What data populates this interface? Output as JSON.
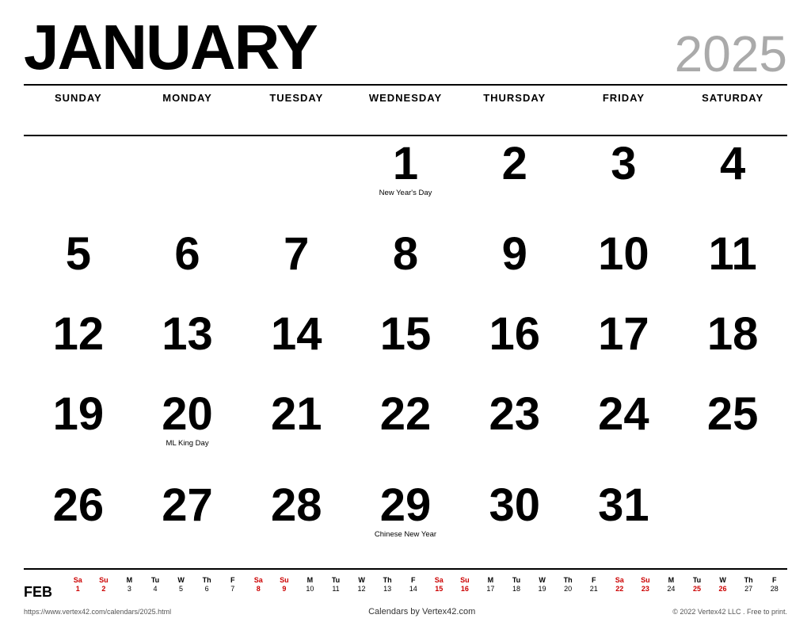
{
  "header": {
    "month": "JANUARY",
    "year": "2025"
  },
  "day_headers": [
    "SUNDAY",
    "MONDAY",
    "TUESDAY",
    "WEDNESDAY",
    "THURSDAY",
    "FRIDAY",
    "SATURDAY"
  ],
  "weeks": [
    [
      {
        "day": "",
        "holiday": ""
      },
      {
        "day": "",
        "holiday": ""
      },
      {
        "day": "",
        "holiday": ""
      },
      {
        "day": "1",
        "holiday": "New Year's Day"
      },
      {
        "day": "2",
        "holiday": ""
      },
      {
        "day": "3",
        "holiday": ""
      },
      {
        "day": "4",
        "holiday": ""
      }
    ],
    [
      {
        "day": "5",
        "holiday": ""
      },
      {
        "day": "6",
        "holiday": ""
      },
      {
        "day": "7",
        "holiday": ""
      },
      {
        "day": "8",
        "holiday": ""
      },
      {
        "day": "9",
        "holiday": ""
      },
      {
        "day": "10",
        "holiday": ""
      },
      {
        "day": "11",
        "holiday": ""
      }
    ],
    [
      {
        "day": "12",
        "holiday": ""
      },
      {
        "day": "13",
        "holiday": ""
      },
      {
        "day": "14",
        "holiday": ""
      },
      {
        "day": "15",
        "holiday": ""
      },
      {
        "day": "16",
        "holiday": ""
      },
      {
        "day": "17",
        "holiday": ""
      },
      {
        "day": "18",
        "holiday": ""
      }
    ],
    [
      {
        "day": "19",
        "holiday": ""
      },
      {
        "day": "20",
        "holiday": "ML King Day"
      },
      {
        "day": "21",
        "holiday": ""
      },
      {
        "day": "22",
        "holiday": ""
      },
      {
        "day": "23",
        "holiday": ""
      },
      {
        "day": "24",
        "holiday": ""
      },
      {
        "day": "25",
        "holiday": ""
      }
    ],
    [
      {
        "day": "26",
        "holiday": ""
      },
      {
        "day": "27",
        "holiday": ""
      },
      {
        "day": "28",
        "holiday": ""
      },
      {
        "day": "29",
        "holiday": "Chinese New Year"
      },
      {
        "day": "30",
        "holiday": ""
      },
      {
        "day": "31",
        "holiday": ""
      },
      {
        "day": "",
        "holiday": ""
      }
    ]
  ],
  "mini_calendar": {
    "month_label": "FEB",
    "day_headers": [
      "Sa",
      "Su",
      "M",
      "Tu",
      "W",
      "Th",
      "F",
      "Sa",
      "Su",
      "M",
      "Tu",
      "W",
      "Th",
      "F",
      "Sa",
      "Su",
      "M",
      "Tu",
      "W",
      "Th",
      "F",
      "Sa",
      "Su",
      "M",
      "Tu",
      "W",
      "Th",
      "F"
    ],
    "days": [
      "1",
      "2",
      "3",
      "4",
      "5",
      "6",
      "7",
      "8",
      "9",
      "10",
      "11",
      "12",
      "13",
      "14",
      "15",
      "16",
      "17",
      "18",
      "19",
      "20",
      "21",
      "22",
      "23",
      "24",
      "25",
      "26",
      "27",
      "28"
    ],
    "red_indices": [
      0,
      1,
      7,
      8,
      14,
      15,
      21,
      22,
      24,
      25
    ]
  },
  "footer": {
    "url": "https://www.vertex42.com/calendars/2025.html",
    "credit": "Calendars by Vertex42.com",
    "copyright": "© 2022 Vertex42 LLC . Free to print."
  }
}
